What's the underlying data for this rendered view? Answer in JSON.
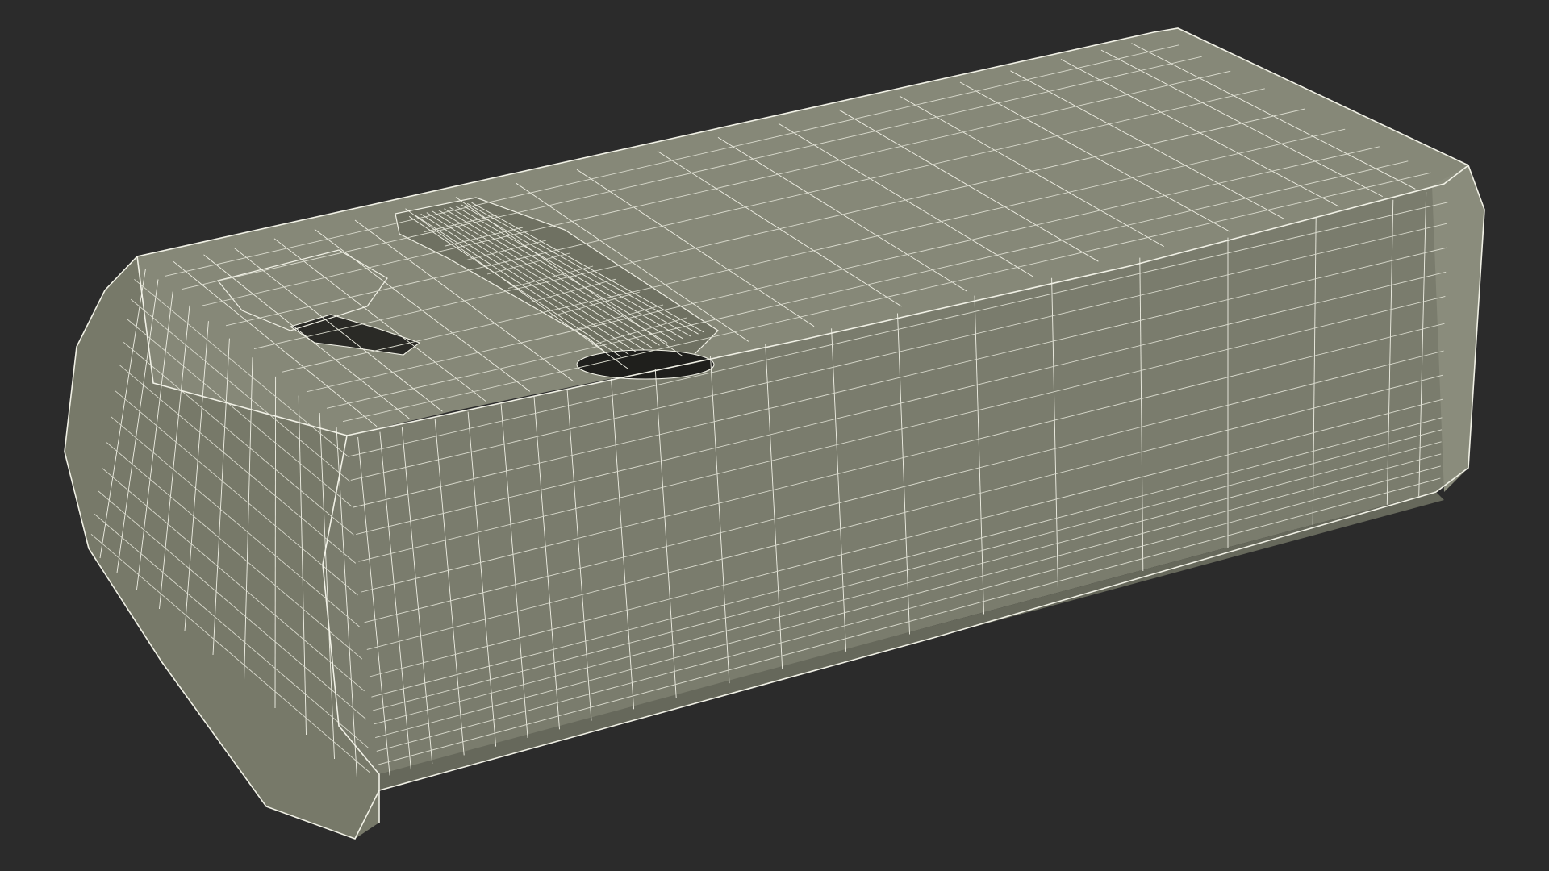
{
  "scene": {
    "subject": "wireframe-3d-model",
    "colors": {
      "background": "#2b2b2b",
      "surface_top": "#868878",
      "surface_side": "#7a7c6d",
      "surface_front": "#6f7163",
      "surface_end": "#7b7d6e",
      "wire": "#f1f1e6",
      "wire_dim": "#d9dacd",
      "recess": "#1f1f1c"
    },
    "icons": {
      "model": "wireframe-mesh-icon"
    }
  }
}
